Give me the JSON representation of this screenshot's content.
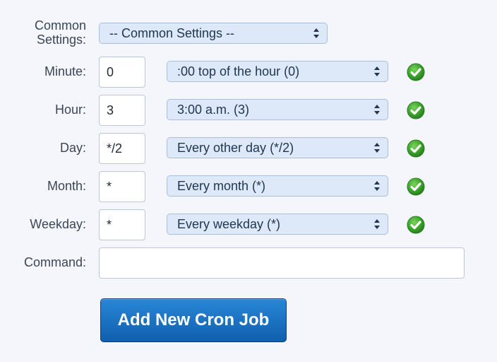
{
  "common": {
    "label_line1": "Common",
    "label_line2": "Settings:",
    "select_value": "-- Common Settings --"
  },
  "minute": {
    "label": "Minute:",
    "value": "0",
    "select_value": ":00 top of the hour (0)"
  },
  "hour": {
    "label": "Hour:",
    "value": "3",
    "select_value": "3:00 a.m. (3)"
  },
  "day": {
    "label": "Day:",
    "value": "*/2",
    "select_value": "Every other day (*/2)"
  },
  "month": {
    "label": "Month:",
    "value": "*",
    "select_value": "Every month (*)"
  },
  "weekday": {
    "label": "Weekday:",
    "value": "*",
    "select_value": "Every weekday (*)"
  },
  "command": {
    "label": "Command:",
    "value": ""
  },
  "submit": {
    "label": "Add New Cron Job"
  },
  "icons": {
    "valid": "check-circle-icon",
    "select_arrows": "up-down-arrows-icon"
  },
  "colors": {
    "background": "#f4f6fb",
    "select_bg": "#dde9f8",
    "button_top": "#2a86d6",
    "button_bottom": "#0f5fae",
    "check_green": "#3aa12c"
  }
}
